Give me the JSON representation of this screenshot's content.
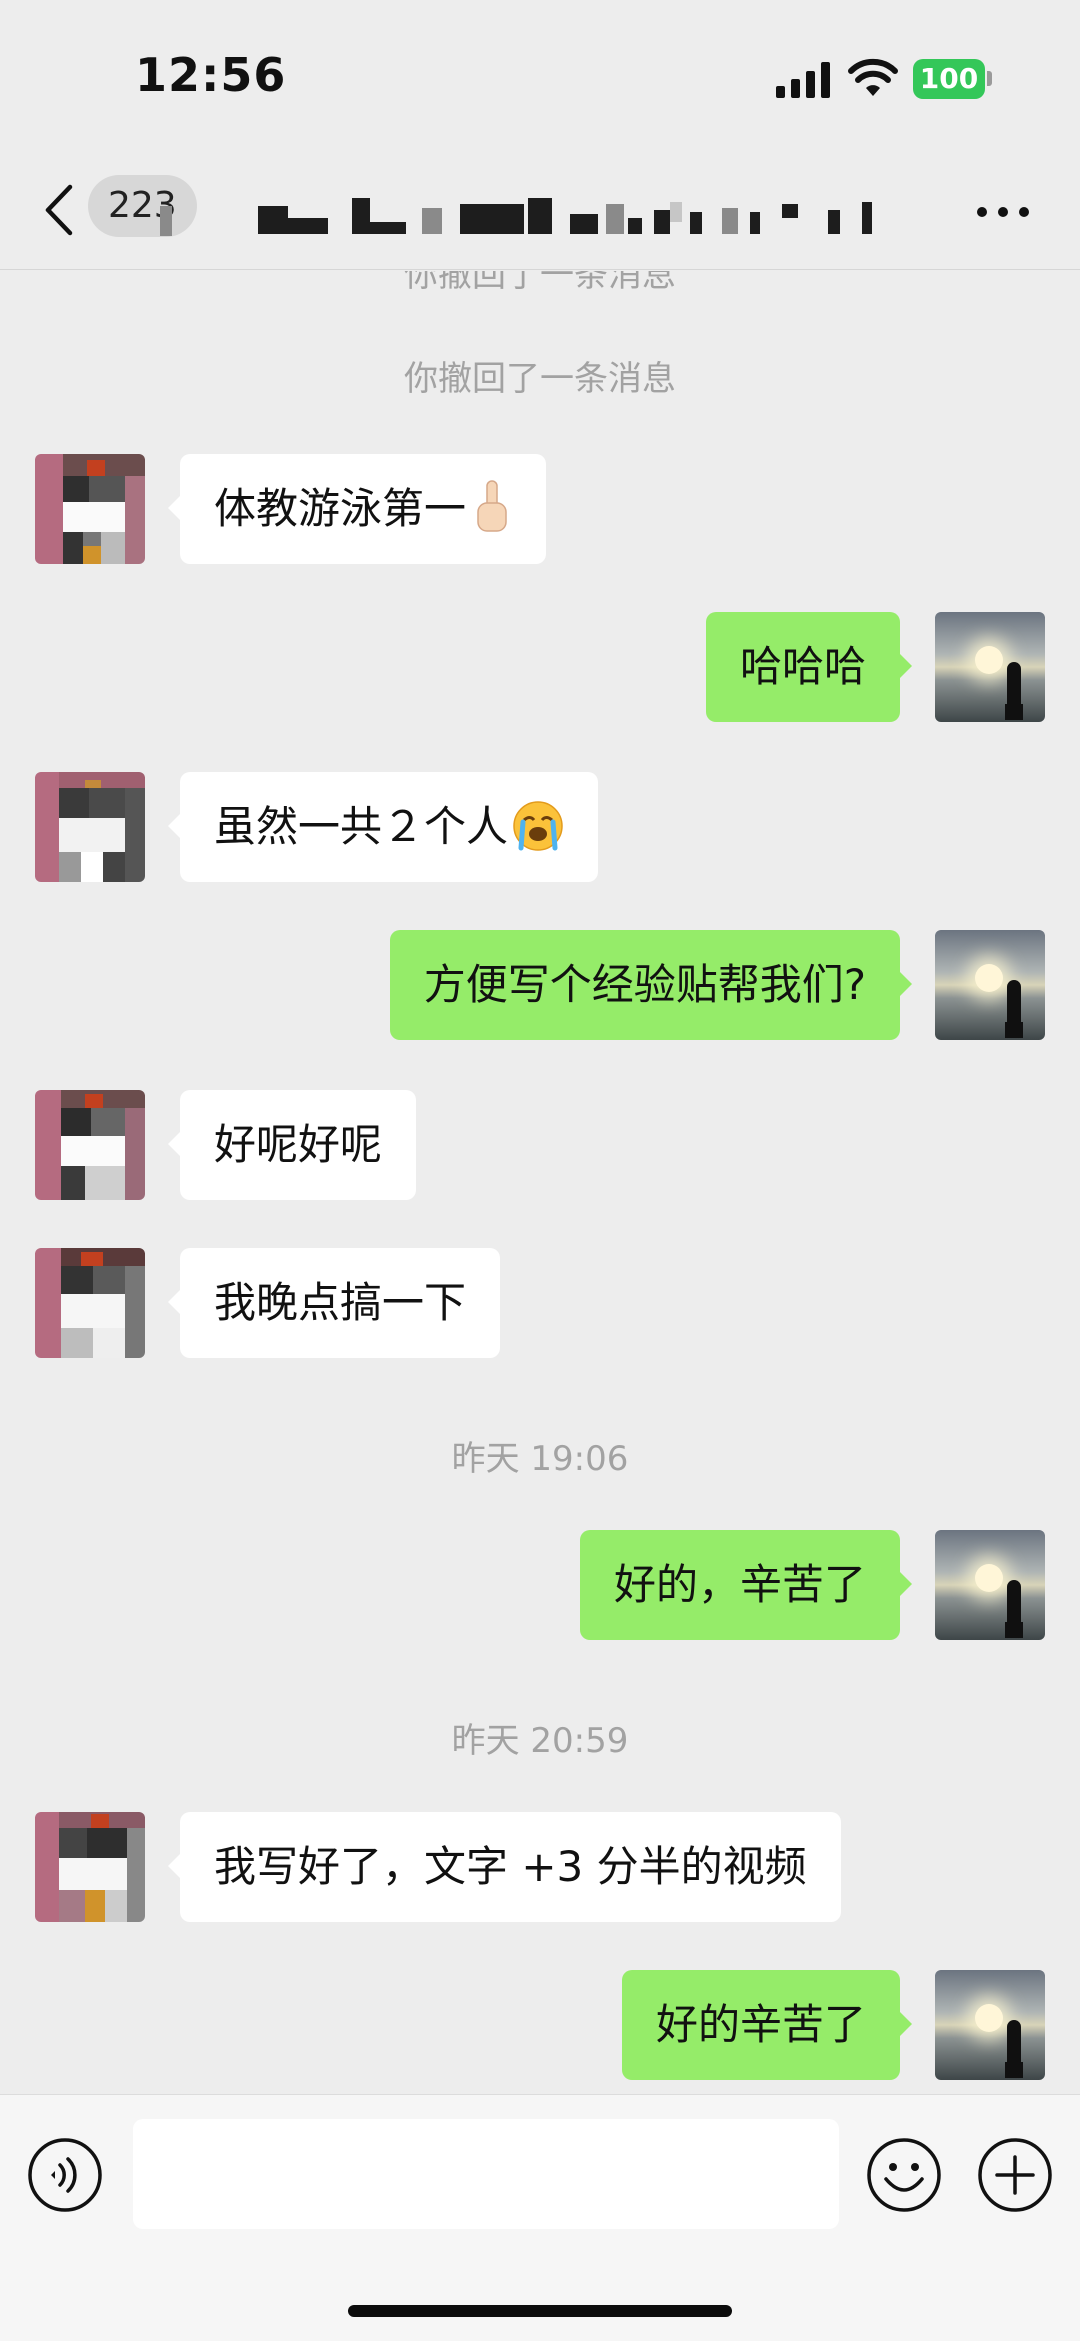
{
  "status_bar": {
    "time": "12:56",
    "battery": "100",
    "icons": [
      "signal-icon",
      "wifi-icon",
      "battery-icon"
    ]
  },
  "nav": {
    "back_icon": "chevron-left-icon",
    "unread_count": "223",
    "title": "",
    "more_icon": "more-dots-icon"
  },
  "messages": {
    "recall_partial": "你撤回了一条消息",
    "recall": "你撤回了一条消息",
    "items": [
      {
        "from": "other",
        "text": "体教游泳第一",
        "emoji": "index-pointing-up"
      },
      {
        "from": "self",
        "text": "哈哈哈"
      },
      {
        "from": "other",
        "text": "虽然一共２个人",
        "emoji": "loudly-crying-face"
      },
      {
        "from": "self",
        "text": "方便写个经验贴帮我们?"
      },
      {
        "from": "other",
        "text": "好呢好呢"
      },
      {
        "from": "other",
        "text": "我晚点搞一下"
      },
      {
        "from": "self",
        "text": "好的，辛苦了"
      },
      {
        "from": "other",
        "text": "我写好了，文字 +3 分半的视频"
      },
      {
        "from": "self",
        "text": "好的辛苦了"
      }
    ],
    "timestamps": [
      "昨天 19:06",
      "昨天 20:59"
    ]
  },
  "input_bar": {
    "voice_icon": "voice-icon",
    "placeholder": "",
    "emoji_icon": "emoji-icon",
    "plus_icon": "plus-icon"
  },
  "colors": {
    "background": "#ededed",
    "self_bubble": "#95ec69",
    "other_bubble": "#ffffff",
    "timestamp_text": "#a2a2a2",
    "battery": "#34c759"
  }
}
